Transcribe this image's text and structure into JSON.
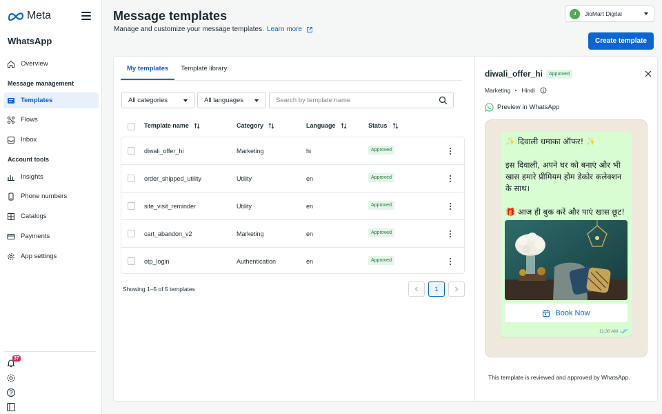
{
  "brand": {
    "logo_text": "Meta",
    "app_name": "WhatsApp"
  },
  "sidebar": {
    "items_top": [
      {
        "label": "Overview",
        "icon": "home-icon"
      }
    ],
    "section_management": "Message management",
    "items_management": [
      {
        "label": "Templates",
        "icon": "templates-icon",
        "active": true
      },
      {
        "label": "Flows",
        "icon": "flows-icon"
      },
      {
        "label": "Inbox",
        "icon": "inbox-icon"
      }
    ],
    "section_tools": "Account tools",
    "items_tools": [
      {
        "label": "Insights",
        "icon": "bar-chart-icon"
      },
      {
        "label": "Phone numbers",
        "icon": "phone-icon"
      },
      {
        "label": "Catalogs",
        "icon": "grid-icon"
      },
      {
        "label": "Payments",
        "icon": "card-icon"
      },
      {
        "label": "App settings",
        "icon": "gear-icon"
      }
    ],
    "notification_count": "37",
    "bottom_icons": [
      "bell-icon",
      "settings-icon",
      "help-icon",
      "panel-icon"
    ]
  },
  "header": {
    "title": "Message templates",
    "subtitle": "Manage and customize your message templates.",
    "learn_more": "Learn more",
    "account_name": "JioMart Digital",
    "account_initial": "J",
    "create_button": "Create template"
  },
  "tabs": [
    {
      "label": "My templates",
      "active": true
    },
    {
      "label": "Template library",
      "active": false
    }
  ],
  "filters": {
    "category": "All categories",
    "language": "All languages",
    "search_placeholder": "Search by template name"
  },
  "table": {
    "columns": [
      "Template name",
      "Category",
      "Language",
      "Status"
    ],
    "rows": [
      {
        "name": "diwali_offer_hi",
        "category": "Marketing",
        "language": "hi",
        "status": "Approved"
      },
      {
        "name": "order_shipped_utility",
        "category": "Utility",
        "language": "en",
        "status": "Approved"
      },
      {
        "name": "site_visit_reminder",
        "category": "Utility",
        "language": "en",
        "status": "Approved"
      },
      {
        "name": "cart_abandon_v2",
        "category": "Marketing",
        "language": "en",
        "status": "Approved"
      },
      {
        "name": "otp_login",
        "category": "Authentication",
        "language": "en",
        "status": "Approved"
      }
    ],
    "showing": "Showing 1–5 of 5 templates",
    "current_page": "1"
  },
  "preview": {
    "template_name": "diwali_offer_hi",
    "status": "Approved",
    "category": "Marketing",
    "language": "Hindi",
    "preview_label": "Preview in WhatsApp",
    "message_lines": [
      "✨ दिवाली धमाका ऑफर! ✨",
      "इस दिवाली, अपने घर को बनाएं और भी खास हमारे प्रीमियम होम डेकोर कलेक्शन के साथ।",
      "🎁 आज ही बुक करें और पाएं खास छूट!"
    ],
    "cta_label": "Book Now",
    "time": "11:30 AM",
    "footer_note": "This template is reviewed and approved by WhatsApp."
  },
  "colors": {
    "accent": "#0a66d4",
    "approved_bg": "#e5f5ea",
    "approved_text": "#1e7a3a",
    "bubble": "#d9fdd3",
    "chat_bg": "#efe8dc"
  }
}
